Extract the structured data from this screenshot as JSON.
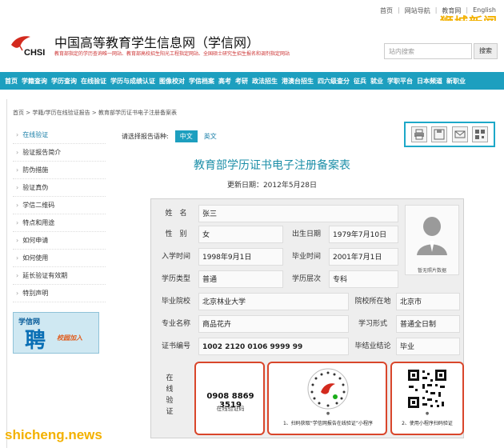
{
  "topbar": {
    "links": [
      "首页",
      "网站导航",
      "教育网",
      "English"
    ],
    "watermark": "狮城新闻"
  },
  "header": {
    "title": "中国高等教育学生信息网（学信网）",
    "subtitle": "教育部指定的学历查询唯一网站、教育部高校招生阳光工程指定网站、全国硕士研究生招生报名和调剂指定网站",
    "logo_text": "CHSI",
    "search_placeholder": "站内搜索",
    "search_button": "搜索"
  },
  "nav": {
    "items": [
      "首页",
      "学籍查询",
      "学历查询",
      "在线验证",
      "学历与成绩认证",
      "图像校对",
      "学信档案",
      "高考",
      "考研",
      "政法招生",
      "港澳台招生",
      "四六级查分",
      "征兵",
      "就业",
      "学职平台",
      "日本频道",
      "新职业"
    ]
  },
  "breadcrumb": "首页 > 学籍/学历在线验证报告 > 教育部学历证书电子注册备案表",
  "sidebar": {
    "items": [
      {
        "label": "在线验证",
        "active": true
      },
      {
        "label": "验证报告简介"
      },
      {
        "label": "防伪措施"
      },
      {
        "label": "验证真伪"
      },
      {
        "label": "学信二维码"
      },
      {
        "label": "特点和用途"
      },
      {
        "label": "如何申请"
      },
      {
        "label": "如何使用"
      },
      {
        "label": "延长验证有效期"
      },
      {
        "label": "特别声明"
      }
    ],
    "ad": {
      "logo": "学信网",
      "big": "聘",
      "small": "校园加入"
    }
  },
  "language": {
    "prompt": "请选择报告语种:",
    "chinese": "中文",
    "english": "英文"
  },
  "tools": {
    "icons": [
      "print-icon",
      "save-icon",
      "mail-icon",
      "qr-icon"
    ]
  },
  "document": {
    "title": "教育部学历证书电子注册备案表",
    "date": "更新日期：2012年5月28日"
  },
  "record": {
    "labels": {
      "name": "姓　名",
      "gender": "性　别",
      "birth": "出生日期",
      "enroll": "入学时间",
      "graduate": "毕业时间",
      "edu_type": "学历类型",
      "level": "学历层次",
      "school": "毕业院校",
      "location": "院校所在地",
      "major": "专业名称",
      "study_form": "学习形式",
      "cert_no": "证书编号",
      "conclusion": "毕结业结论"
    },
    "values": {
      "name": "张三",
      "gender": "女",
      "birth": "1979年7月10日",
      "enroll": "1998年9月1日",
      "graduate": "2001年7月1日",
      "edu_type": "普通",
      "level": "专科",
      "school": "北京林业大学",
      "location": "北京市",
      "major": "商品花卉",
      "study_form": "普通全日制",
      "cert_no": "1002 2120 0106 9999 99",
      "conclusion": "毕业"
    },
    "photo_caption": "暂无照片数据"
  },
  "verification": {
    "label": "在线验证",
    "code": "0908 8869 3519",
    "code_caption": "在线验证码",
    "qr1_caption": "1、扫码获取“学信网报告在线验证”小程序",
    "qr2_caption": "2、使用小程序扫码验证"
  },
  "watermark_bottom": "shicheng.news"
}
